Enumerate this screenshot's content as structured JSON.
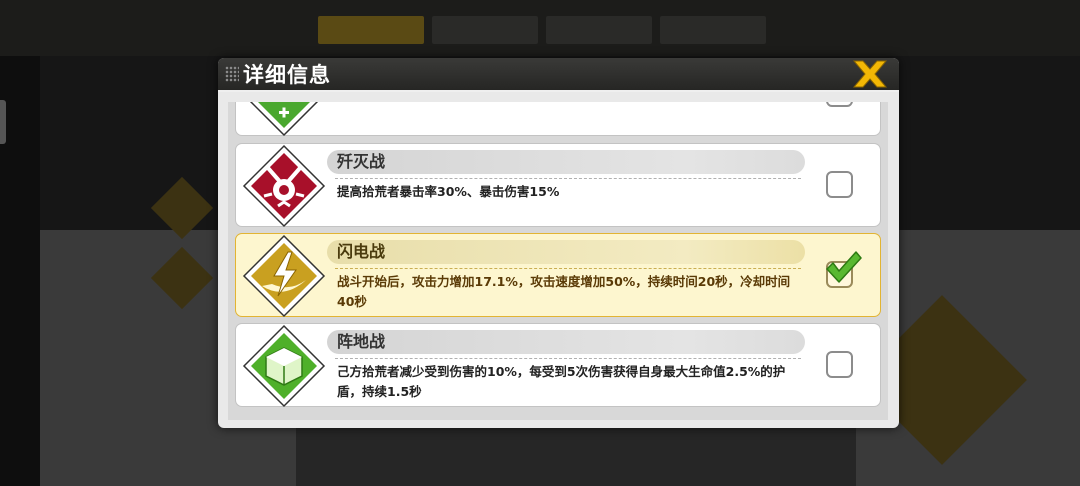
{
  "modal": {
    "title": "详细信息"
  },
  "tactics": [
    {
      "name": "",
      "desc": "",
      "selected": false,
      "icon": "green-plus-icon",
      "color": "#4aa82f"
    },
    {
      "name": "歼灭战",
      "desc": "提高拾荒者暴击率30%、暴击伤害15%",
      "selected": false,
      "icon": "annihilation-icon",
      "color": "#a8102a"
    },
    {
      "name": "闪电战",
      "desc": "战斗开始后，攻击力增加17.1%，攻击速度增加50%，持续时间20秒，冷却时间40秒",
      "selected": true,
      "icon": "lightning-icon",
      "color": "#c9a020"
    },
    {
      "name": "阵地战",
      "desc": "己方拾荒者减少受到伤害的10%，每受到5次伤害获得自身最大生命值2.5%的护盾，持续1.5秒",
      "selected": false,
      "icon": "fortress-icon",
      "color": "#4fb02a"
    }
  ],
  "colors": {
    "accent": "#f2b705",
    "check": "#59b830",
    "selected_border": "#e2b433"
  }
}
